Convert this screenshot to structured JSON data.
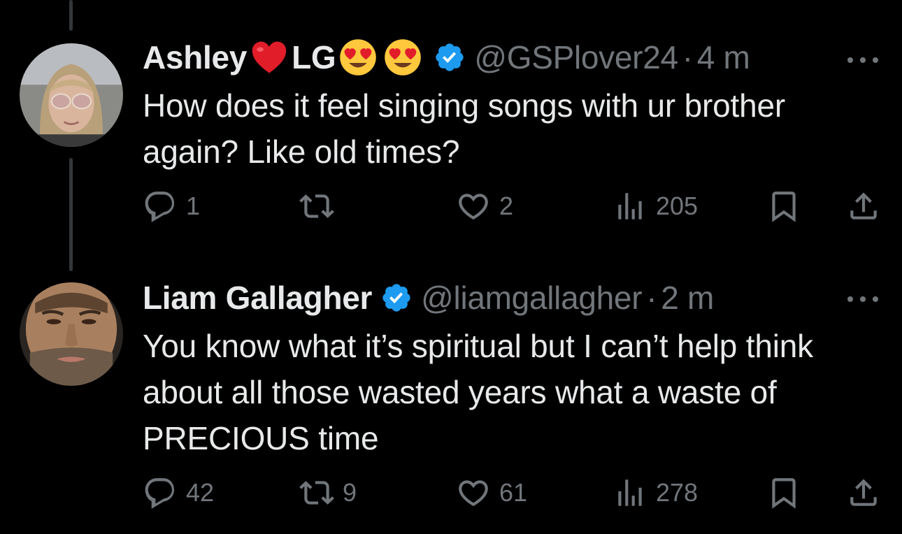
{
  "colors": {
    "background": "#000000",
    "text": "#e7e9ea",
    "muted": "#71767b",
    "verified": "#1d9bf0",
    "thread_line": "#333639"
  },
  "tweets": [
    {
      "display_name": "Ashley",
      "display_name_suffix": "LG",
      "name_emojis": [
        "red-heart-emoji",
        "heart-eyes-emoji",
        "heart-eyes-emoji"
      ],
      "verified": true,
      "handle": "@GSPlover24",
      "separator": "·",
      "time": "4 m",
      "text": "How does it feel singing songs with ur brother again? Like old times?",
      "actions": {
        "replies": "1",
        "reposts": "",
        "likes": "2",
        "views": "205"
      },
      "icons": [
        "reply-icon",
        "repost-icon",
        "like-icon",
        "views-icon",
        "bookmark-icon",
        "share-icon",
        "more-icon"
      ]
    },
    {
      "display_name": "Liam Gallagher",
      "verified": true,
      "handle": "@liamgallagher",
      "separator": "·",
      "time": "2 m",
      "text": "You know what it’s spiritual but I can’t help think about all those wasted years what a waste of PRECIOUS time",
      "actions": {
        "replies": "42",
        "reposts": "9",
        "likes": "61",
        "views": "278"
      },
      "icons": [
        "reply-icon",
        "repost-icon",
        "like-icon",
        "views-icon",
        "bookmark-icon",
        "share-icon",
        "more-icon"
      ]
    }
  ]
}
